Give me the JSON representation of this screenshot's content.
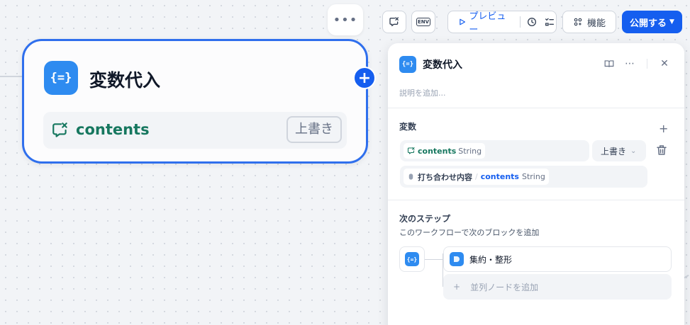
{
  "node": {
    "title": "変数代入",
    "icon": "variable-assign-icon",
    "more_label": "•••",
    "variable_name": "contents",
    "mode_badge": "上書き"
  },
  "toolbar": {
    "preview_label": "プレビュー",
    "env_label": "ENV",
    "features_label": "機能",
    "publish_label": "公開する"
  },
  "panel": {
    "title": "変数代入",
    "description_placeholder": "説明を追加...",
    "variables_section_title": "変数",
    "assignment": {
      "target_name": "contents",
      "target_type": "String",
      "mode": "上書き",
      "source_node": "打ち合わせ内容",
      "source_name": "contents",
      "source_type": "String"
    },
    "next_step": {
      "title": "次のステップ",
      "subtitle": "このワークフローで次のブロックを追加",
      "next_node_label": "集約・整形",
      "add_parallel_label": "並列ノードを追加"
    }
  },
  "colors": {
    "accent": "#155eef",
    "node_icon": "#2e8bf0",
    "variable_green": "#16775f"
  }
}
